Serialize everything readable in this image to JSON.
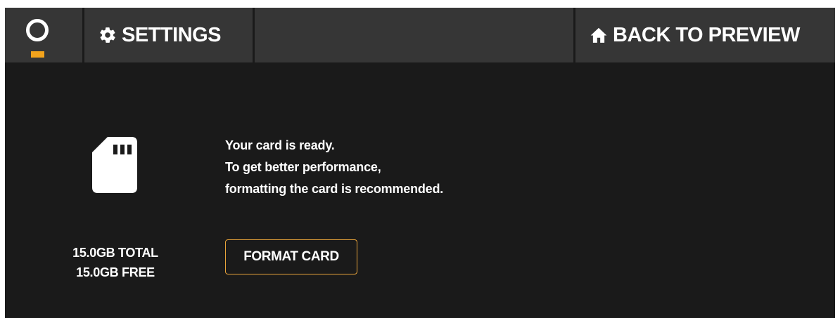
{
  "header": {
    "logo_icon": "circle-logo-icon",
    "settings_icon": "gear-icon",
    "settings_label": "SETTINGS",
    "back_icon": "home-icon",
    "back_label": "BACK TO PREVIEW"
  },
  "card": {
    "icon": "sd-card-icon",
    "total": "15.0GB TOTAL",
    "free": "15.0GB FREE",
    "message_lines": [
      "Your card is ready.",
      "To get better performance,",
      "formatting the card is recommended."
    ],
    "format_button_label": "FORMAT CARD"
  },
  "colors": {
    "accent": "#f2a31c",
    "button_border": "#e8a33a",
    "background": "#1a1a1a",
    "topbar": "#363636",
    "text": "#ffffff"
  }
}
